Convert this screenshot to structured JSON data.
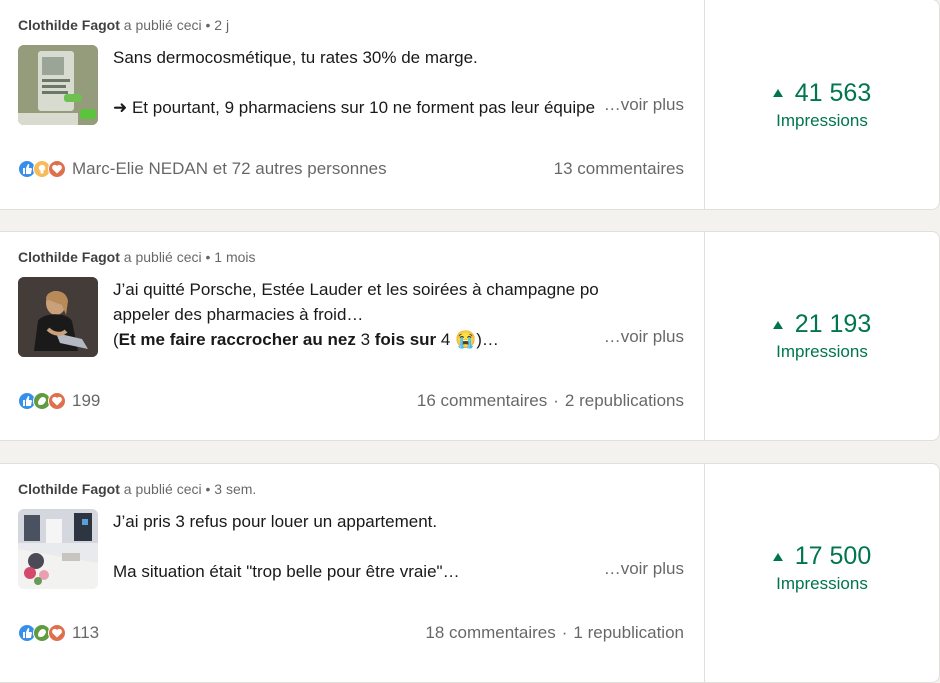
{
  "posts": [
    {
      "author": "Clothilde Fagot",
      "action": "a publié ceci",
      "time": "2 j",
      "lines": [
        "Sans dermocosmétique, tu rates 30% de marge.",
        "",
        "➜ Et pourtant, 9 pharmaciens sur 10 ne forment pas leur équipe"
      ],
      "see_more": "…voir plus",
      "reactions_text": "Marc-Elie NEDAN et 72 autres personnes",
      "reaction_icons": [
        "like-icon",
        "idea-icon",
        "love-icon"
      ],
      "comments": "13 commentaires",
      "reposts": "",
      "impressions_value": "41 563",
      "impressions_label": "Impressions",
      "thumb_alt": "screenshot thumbnail"
    },
    {
      "author": "Clothilde Fagot",
      "action": "a publié ceci",
      "time": "1 mois",
      "lines": [
        "J’ai quitté Porsche, Estée Lauder et les soirées à champagne pour…",
        "appeler des pharmacies à froid…"
      ],
      "line3_parts": [
        {
          "t": "(",
          "b": false
        },
        {
          "t": "Et me faire raccrocher au nez",
          "b": true
        },
        {
          "t": " 3 ",
          "b": false
        },
        {
          "t": "fois sur",
          "b": true
        },
        {
          "t": " 4 ",
          "b": false
        },
        {
          "t": "😭",
          "b": false
        },
        {
          "t": ")…",
          "b": false
        }
      ],
      "see_more": "…voir plus",
      "reactions_text": "199",
      "reaction_icons": [
        "like-icon",
        "support-icon",
        "love-icon"
      ],
      "comments": "16 commentaires",
      "reposts": "2 republications",
      "impressions_value": "21 193",
      "impressions_label": "Impressions"
    },
    {
      "author": "Clothilde Fagot",
      "action": "a publié ceci",
      "time": "3 sem.",
      "lines": [
        "J’ai pris 3 refus pour louer un appartement.",
        "",
        "Ma situation était \"trop belle pour être vraie\"…"
      ],
      "see_more": "…voir plus",
      "reactions_text": "113",
      "reaction_icons": [
        "like-icon",
        "support-icon",
        "love-icon"
      ],
      "comments": "18 commentaires",
      "reposts": "1 republication",
      "impressions_value": "17 500",
      "impressions_label": "Impressions"
    }
  ],
  "separator": "•",
  "stat_separator": "·",
  "colors": {
    "accent_green": "#01754f",
    "like": "#378fe9",
    "idea": "#f5bb5c",
    "love": "#df704d",
    "support": "#5f9b41"
  }
}
